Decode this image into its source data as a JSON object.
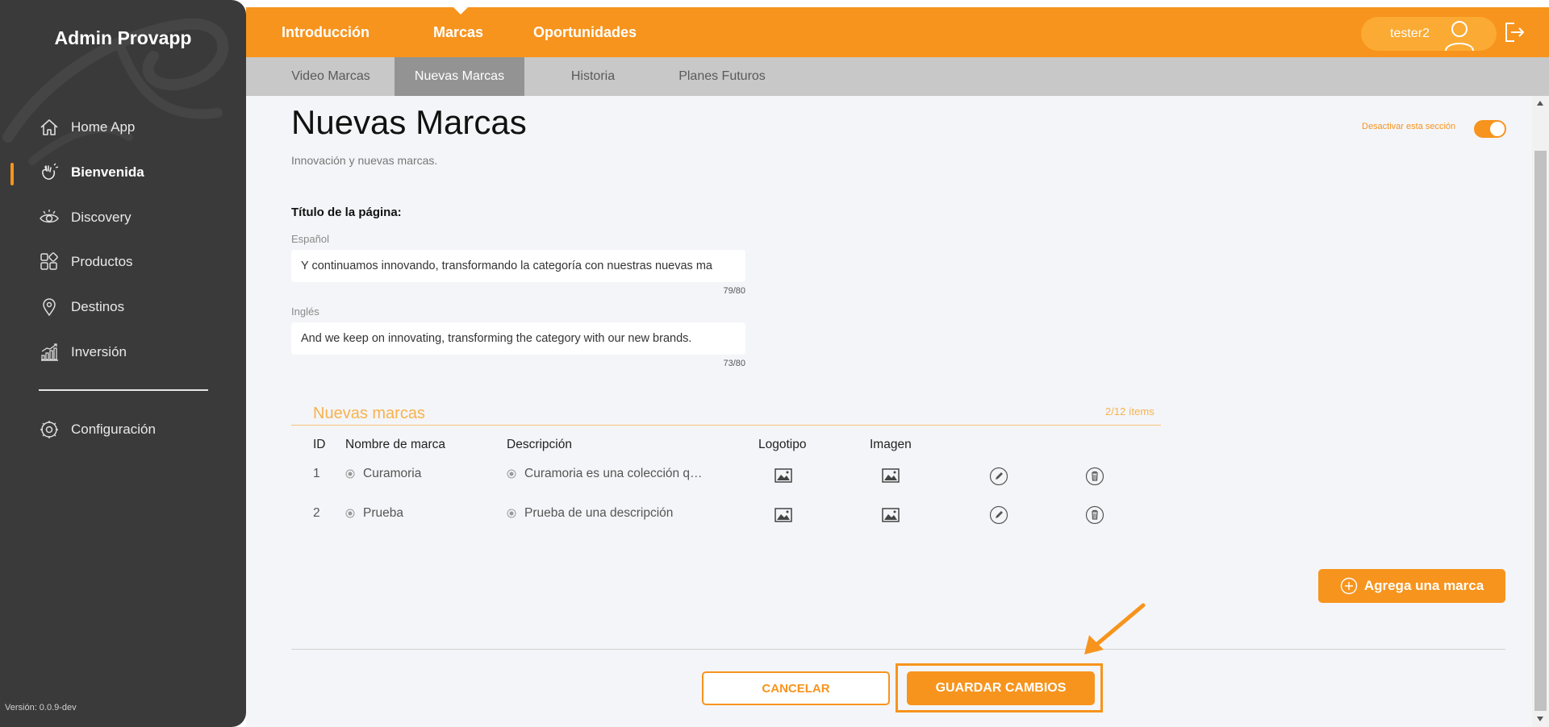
{
  "app": {
    "brand": "Admin Provapp",
    "version": "Versión: 0.0.9-dev"
  },
  "colors": {
    "accent": "#f7941d",
    "sidebar": "#3a3a3a",
    "subnav": "#c8c8c8",
    "subnav_active": "#939393"
  },
  "sidebar": {
    "items": [
      {
        "label": "Home App",
        "icon": "home-icon"
      },
      {
        "label": "Bienvenida",
        "icon": "hands-icon",
        "active": true
      },
      {
        "label": "Discovery",
        "icon": "eye-icon"
      },
      {
        "label": "Productos",
        "icon": "grid-icon"
      },
      {
        "label": "Destinos",
        "icon": "location-pin-icon"
      },
      {
        "label": "Inversión",
        "icon": "bar-chart-icon"
      },
      {
        "label": "Configuración",
        "icon": "gear-icon"
      }
    ]
  },
  "topnav": {
    "tabs": [
      {
        "label": "Introducción"
      },
      {
        "label": "Marcas",
        "active": true
      },
      {
        "label": "Oportunidades"
      }
    ],
    "user": "tester2"
  },
  "subnav": {
    "tabs": [
      {
        "label": "Video Marcas"
      },
      {
        "label": "Nuevas Marcas",
        "active": true
      },
      {
        "label": "Historia"
      },
      {
        "label": "Planes Futuros"
      }
    ]
  },
  "page": {
    "title": "Nuevas Marcas",
    "subtitle": "Innovación y nuevas marcas.",
    "toggle_label": "Desactivar esta sección",
    "toggle_on": true,
    "section_label": "Título de la página:",
    "fields": {
      "es": {
        "label": "Español",
        "value": "Y continuamos innovando, transformando la categoría con nuestras nuevas ma",
        "counter": "79/80"
      },
      "en": {
        "label": "Inglés",
        "value": "And we keep on innovating, transforming the category with our new brands.",
        "counter": "73/80"
      }
    }
  },
  "brands": {
    "title": "Nuevas marcas",
    "count": "2/12 ítems",
    "headers": {
      "id": "ID",
      "name": "Nombre de marca",
      "description": "Descripción",
      "logo": "Logotipo",
      "image": "Imagen"
    },
    "rows": [
      {
        "id": "1",
        "name": "Curamoria",
        "description": "Curamoria es una colección q…"
      },
      {
        "id": "2",
        "name": "Prueba",
        "description": "Prueba de una descripción"
      }
    ],
    "add_label": "Agrega una marca"
  },
  "actions": {
    "cancel": "CANCELAR",
    "save": "GUARDAR CAMBIOS"
  }
}
